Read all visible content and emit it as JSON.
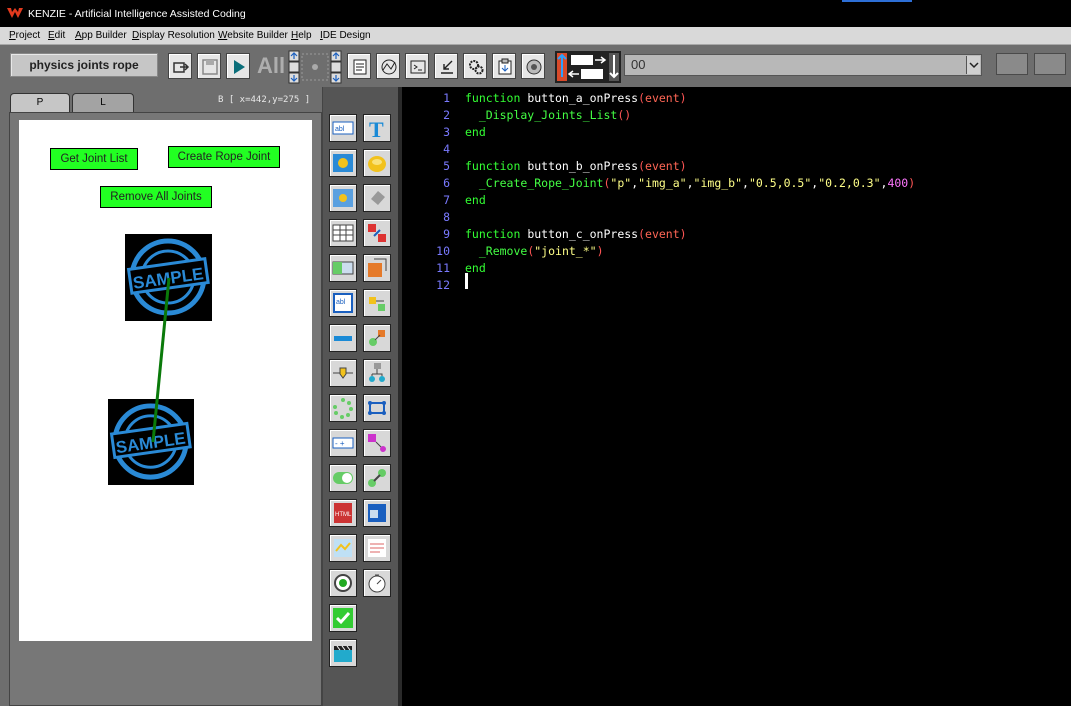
{
  "app": {
    "title": "KENZIE - Artificial Intelligence Assisted Coding"
  },
  "menu": [
    "Project",
    "Edit",
    "App Builder",
    "Display Resolution",
    "Website Builder",
    "Help",
    "IDE Design"
  ],
  "toolbar": {
    "project_name": "physics joints rope",
    "all_label": "All",
    "combo_value": "00"
  },
  "tabs": [
    "P",
    "L"
  ],
  "coords": "B [ x=442,y=275 ]",
  "stage": {
    "buttons": [
      "Get Joint List",
      "Create Rope Joint",
      "Remove All Joints"
    ],
    "image_text": "SAMPLE",
    "joint_color": "#0a7a0a"
  },
  "editor": {
    "line_numbers": [
      "1",
      "2",
      "3",
      "4",
      "5",
      "6",
      "7",
      "8",
      "9",
      "10",
      "11",
      "12"
    ],
    "lines": [
      [
        "function",
        " button_a_onPress",
        "(",
        "event",
        ")"
      ],
      [
        "  _Display_Joints_List",
        "()"
      ],
      [
        "end"
      ],
      [],
      [
        "function",
        " button_b_onPress",
        "(",
        "event",
        ")"
      ],
      [
        "  _Create_Rope_Joint",
        "(",
        "\"p\"",
        ",",
        "\"img_a\"",
        ",",
        "\"img_b\"",
        ",",
        "\"0.5,0.5\"",
        ",",
        "\"0.2,0.3\"",
        ",",
        "400",
        ")"
      ],
      [
        "end"
      ],
      [],
      [
        "function",
        " button_c_onPress",
        "(",
        "event",
        ")"
      ],
      [
        "  _Remove",
        "(",
        "\"joint_*\"",
        ")"
      ],
      [
        "end"
      ],
      []
    ]
  },
  "colors": {
    "keyword": "#33ff33",
    "string": "#ffff88",
    "number": "#ff77ff",
    "paren": "#ff5555",
    "stage_button": "#22ff22"
  }
}
